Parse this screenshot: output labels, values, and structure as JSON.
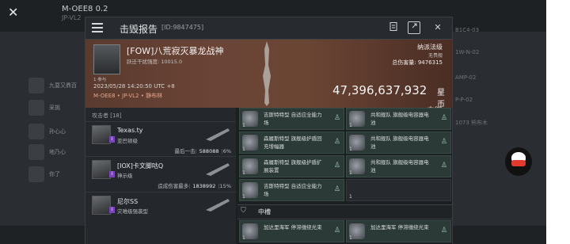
{
  "background": {
    "close_glyph": "✕",
    "name": "M-OEE8 0.2",
    "subtitle": "JP-VL2",
    "chars": [
      "九耍又鼎百",
      "采挑",
      "孙心心",
      "地乃心",
      "你了"
    ],
    "right_labels": [
      "B1C4-03",
      "1W-N-02",
      "AMP-02",
      "P-P-02",
      "1073 熊布木"
    ]
  },
  "dialog": {
    "title": "击毁报告",
    "id_label": "[ID:9847475]",
    "icons": [
      "clipboard-icon",
      "share-icon",
      "close-icon"
    ],
    "close_glyph": "✕"
  },
  "victim": {
    "pilot": "[FOW]八荒寂灭暴龙战神",
    "standing": "跃迁干扰强度: 10015.0",
    "small_caption": "1 参与",
    "timestamp": "2023/05/28 14:20:50 UTC +8",
    "location": "M-OEE8 • JP-VL2 • 静布林",
    "rank_title": "纳派法级",
    "rank_sub": "无畏舰",
    "total_damage_label": "总伤害量:",
    "total_damage": "9476315",
    "value": "47,396,637,932",
    "value_unit": "星币",
    "kill_tag": "击毁"
  },
  "attackers": {
    "label": "攻击者 [18]",
    "items": [
      {
        "name": "Texas.ty",
        "corp": "亚巴顿级",
        "meta_label": "最后一击",
        "damage": "588088",
        "pct": "6%"
      },
      {
        "name": "[IOX]卡文脚咕Q",
        "corp": "神示级",
        "meta_label": "造成伤害最多",
        "damage": "1838992",
        "pct": "15%"
      },
      {
        "name": "尼尔SS",
        "corp": "灾难级强袭型",
        "meta_label": "",
        "damage": "",
        "pct": ""
      }
    ]
  },
  "fitting": {
    "high_slots": [
      {
        "qty": "1",
        "text": "吉斯特特型 自适应全能力场"
      },
      {
        "qty": "1",
        "text": "共和舰队 旗舰级电容器电池"
      },
      {
        "qty": "1",
        "text": "森履斯特型 旗舰级护盾回充增幅器"
      },
      {
        "qty": "1",
        "text": "共和舰队 旗舰级电容器电池"
      },
      {
        "qty": "1",
        "text": "森履斯特型 旗舰级护盾扩展装置"
      },
      {
        "qty": "1",
        "text": "共和舰队 旗舰级电容器电池"
      },
      {
        "qty": "1",
        "text": "吉斯特特型 自适应全能力场"
      },
      {
        "qty": "1",
        "text": ""
      }
    ],
    "section_title": "中槽",
    "mid_slots": [
      {
        "qty": "1",
        "text": "加达里海军 停滞缠绕光束"
      },
      {
        "qty": "1",
        "text": "加达里海军 停滞缠绕光束"
      }
    ]
  }
}
